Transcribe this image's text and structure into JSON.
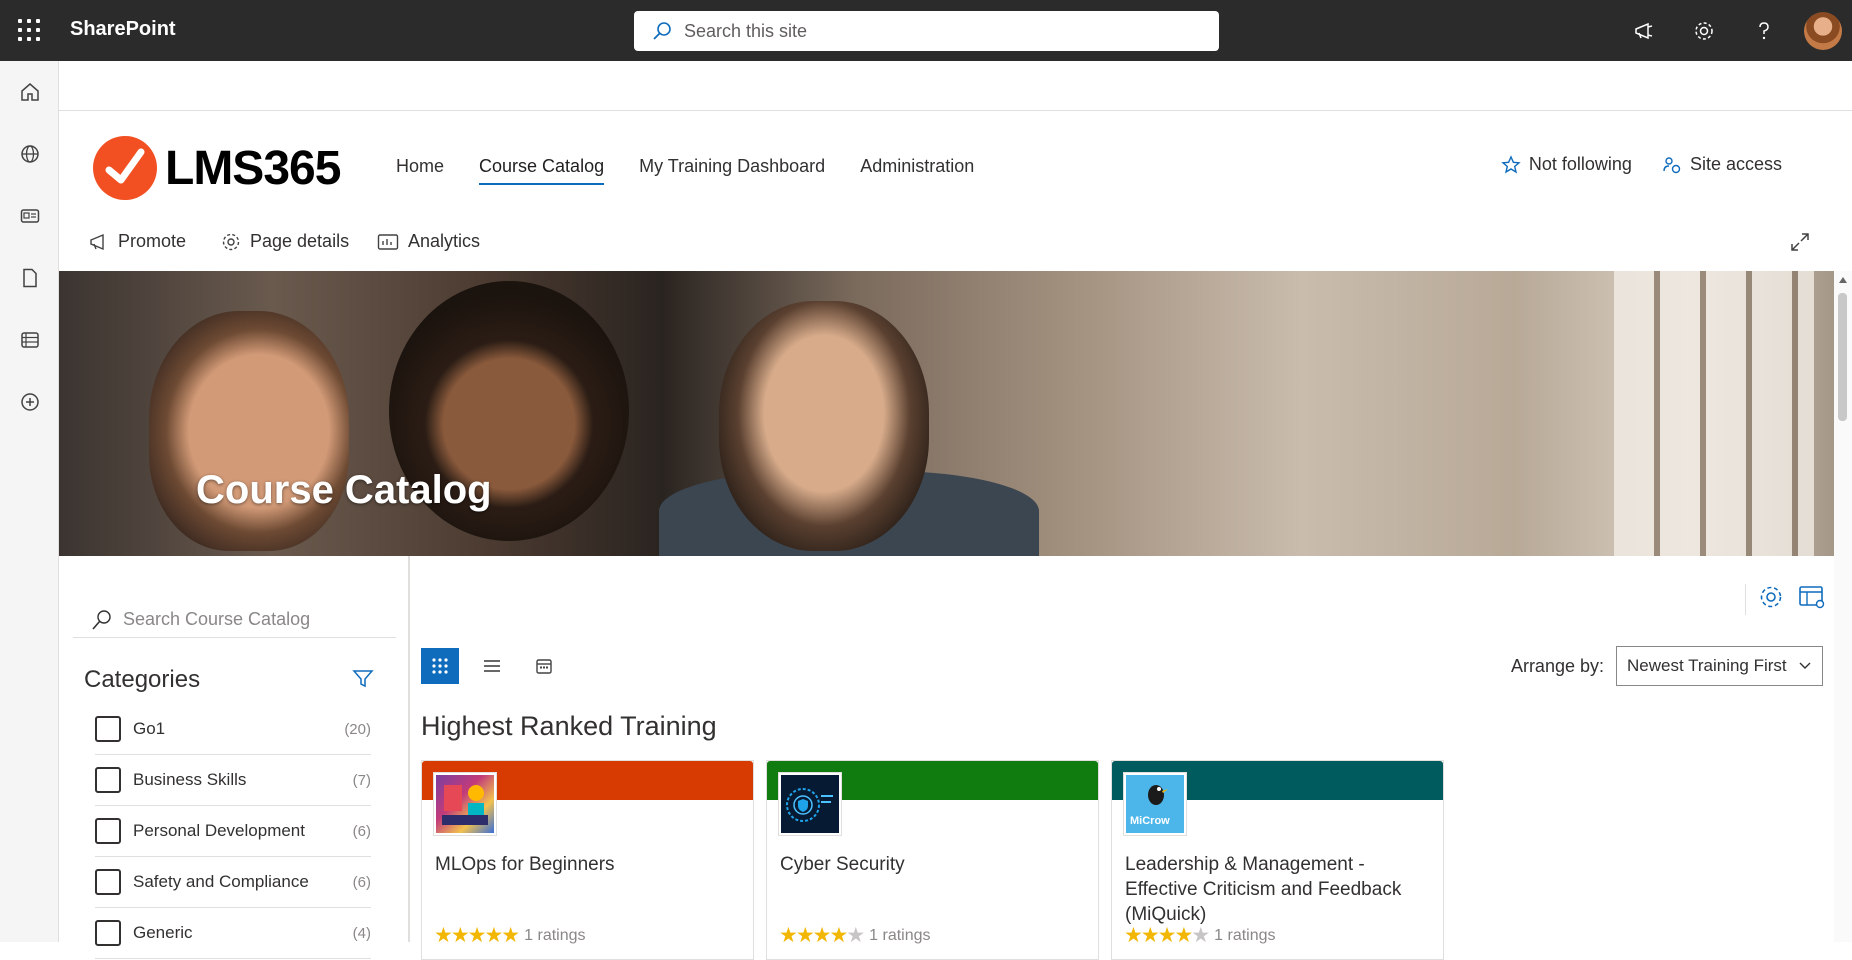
{
  "suite": {
    "app_name": "SharePoint",
    "search_placeholder": "Search this site"
  },
  "site": {
    "logo_text": "LMS365",
    "nav": [
      {
        "label": "Home",
        "active": false
      },
      {
        "label": "Course Catalog",
        "active": true
      },
      {
        "label": "My Training Dashboard",
        "active": false
      },
      {
        "label": "Administration",
        "active": false
      }
    ],
    "follow_label": "Not following",
    "site_access_label": "Site access"
  },
  "commands": {
    "promote": "Promote",
    "page_details": "Page details",
    "analytics": "Analytics"
  },
  "hero": {
    "title": "Course Catalog"
  },
  "catalog": {
    "search_placeholder": "Search Course Catalog",
    "categories_heading": "Categories",
    "categories": [
      {
        "name": "Go1",
        "count": "(20)"
      },
      {
        "name": "Business Skills",
        "count": "(7)"
      },
      {
        "name": "Personal Development",
        "count": "(6)"
      },
      {
        "name": "Safety and Compliance",
        "count": "(6)"
      },
      {
        "name": "Generic",
        "count": "(4)"
      }
    ],
    "arrange_label": "Arrange by:",
    "arrange_value": "Newest Training First",
    "section_title": "Highest Ranked Training",
    "courses": [
      {
        "title": "MLOps for Beginners",
        "band_color": "#d83b01",
        "stars": 5,
        "ratings": "1 ratings"
      },
      {
        "title": "Cyber Security",
        "band_color": "#107c10",
        "stars": 4,
        "ratings": "1 ratings"
      },
      {
        "title": "Leadership & Management - Effective Criticism and Feedback (MiQuick)",
        "band_color": "#005b5f",
        "stars": 4,
        "ratings": "1 ratings",
        "thumb_text": "MiCrow"
      }
    ]
  },
  "colors": {
    "suite_bar": "#2b2b2b",
    "accent": "#0f6cbd",
    "logo_orange": "#f25022"
  }
}
